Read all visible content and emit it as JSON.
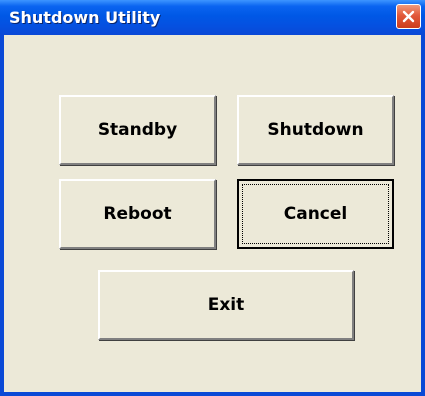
{
  "window": {
    "title": "Shutdown Utility"
  },
  "buttons": {
    "standby": "Standby",
    "shutdown": "Shutdown",
    "reboot": "Reboot",
    "cancel": "Cancel",
    "exit": "Exit"
  },
  "icons": {
    "close": "close-icon"
  },
  "colors": {
    "titlebar": "#0058e6",
    "window_face": "#ece9d8",
    "close_button": "#e2593a"
  }
}
